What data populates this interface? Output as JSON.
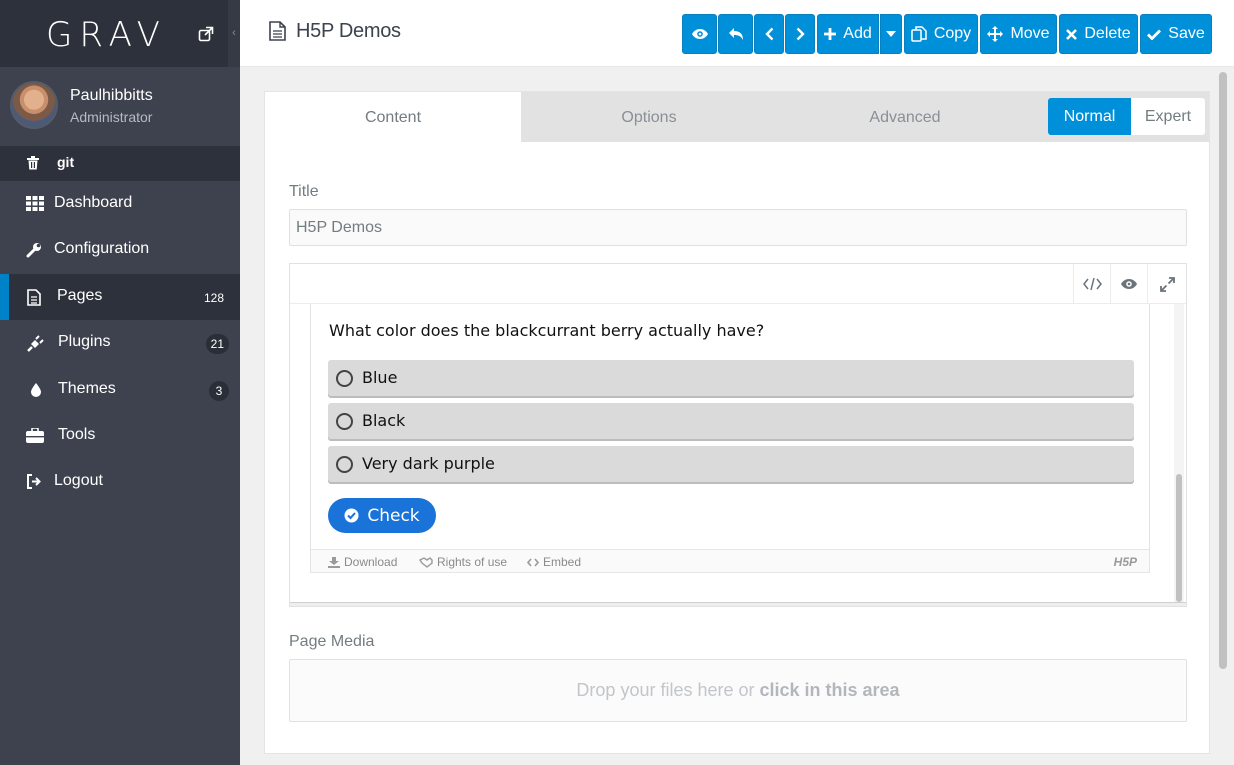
{
  "sidebar": {
    "logo": "GRAV",
    "user": {
      "name": "Paulhibbitts",
      "role": "Administrator"
    },
    "git_label": "git",
    "items": [
      {
        "label": "Dashboard",
        "icon": "grid-icon"
      },
      {
        "label": "Configuration",
        "icon": "wrench-icon"
      },
      {
        "label": "Pages",
        "icon": "file-icon",
        "badge": "128",
        "active": true
      },
      {
        "label": "Plugins",
        "icon": "plug-icon",
        "badge": "21"
      },
      {
        "label": "Themes",
        "icon": "tint-icon",
        "badge": "3"
      },
      {
        "label": "Tools",
        "icon": "briefcase-icon"
      },
      {
        "label": "Logout",
        "icon": "sign-out-icon"
      }
    ]
  },
  "topbar": {
    "title": "H5P Demos",
    "buttons": {
      "add": "Add",
      "copy": "Copy",
      "move": "Move",
      "delete": "Delete",
      "save": "Save"
    }
  },
  "tabs": {
    "content": "Content",
    "options": "Options",
    "advanced": "Advanced"
  },
  "mode": {
    "normal": "Normal",
    "expert": "Expert"
  },
  "form": {
    "title_label": "Title",
    "title_value": "H5P Demos",
    "media_label": "Page Media",
    "drop_text": "Drop your files here or ",
    "drop_link": "click in this area"
  },
  "h5p": {
    "question": "What color does the blackcurrant berry actually have?",
    "answers": [
      "Blue",
      "Black",
      "Very dark purple"
    ],
    "check": "Check",
    "footer": {
      "download": "Download",
      "rights": "Rights of use",
      "embed": "Embed",
      "logo": "H5P"
    }
  },
  "colors": {
    "accent": "#0090d9",
    "sidebar": "#3d424e",
    "sidebar_dark": "#2d313b",
    "h5p_check": "#1a73d9"
  }
}
